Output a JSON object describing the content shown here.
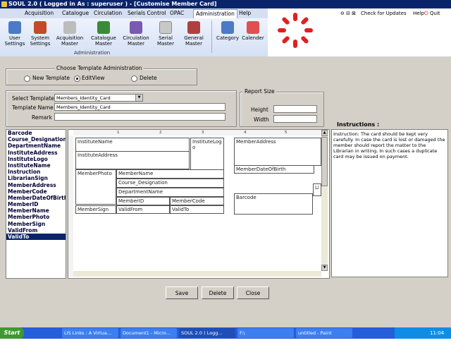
{
  "window": {
    "title": "SOUL 2.0  ( Logged in As : superuser ) - [Customise Member Card]"
  },
  "menu": {
    "items": [
      "Acquisition",
      "Catalogue",
      "Circulation",
      "Serials Control",
      "OPAC",
      "Administration",
      "Help"
    ],
    "active": "Administration"
  },
  "ribbon": {
    "buttons": [
      {
        "label1": "User",
        "label2": "Settings",
        "color": "#4a7ac8"
      },
      {
        "label1": "System",
        "label2": "Settings",
        "color": "#c24a2a"
      },
      {
        "label1": "Acquisition",
        "label2": "Master",
        "color": "#d0d0d0"
      },
      {
        "label1": "Catalogue",
        "label2": "Master",
        "color": "#3a8a3a"
      },
      {
        "label1": "Circulation",
        "label2": "Master",
        "color": "#7a5ab0"
      },
      {
        "label1": "Serial",
        "label2": "Master",
        "color": "#c8c8c8"
      },
      {
        "label1": "General",
        "label2": "Master",
        "color": "#b04040"
      },
      {
        "label1": "Category",
        "label2": "",
        "color": "#4a7ac8"
      },
      {
        "label1": "Calender",
        "label2": "",
        "color": "#e05050"
      }
    ],
    "group_label": "Administration"
  },
  "top_right": {
    "check_updates": "Check for Updates",
    "help": "Help",
    "quit": "Quit"
  },
  "template_admin": {
    "legend": "Choose Template Administration",
    "options": [
      {
        "label": "New Template",
        "selected": false
      },
      {
        "label": "EditView",
        "selected": true
      },
      {
        "label": "Delete",
        "selected": false
      }
    ]
  },
  "form": {
    "select_template_label": "Select Template",
    "select_template_value": "Members_Identity_Card",
    "template_name_label": "Template Name",
    "template_name_value": "Members_Identity_Card",
    "remark_label": "Remark",
    "remark_value": ""
  },
  "report_size": {
    "legend": "Report Size",
    "height_label": "Height",
    "height_value": "",
    "width_label": "Width",
    "width_value": ""
  },
  "fields": {
    "items": [
      "Barcode",
      "Course_Designation",
      "DepartmentName",
      "InstituteAddress",
      "InstituteLogo",
      "InstituteName",
      "Instruction",
      "LibrarianSign",
      "MemberAddress",
      "MemberCode",
      "MemberDateOfBirth",
      "MemberID",
      "MemberName",
      "MemberPhoto",
      "MemberSign",
      "ValidFrom",
      "ValidTo"
    ],
    "selected": "ValidTo"
  },
  "canvas": {
    "ruler_marks": [
      "1",
      "2",
      "3",
      "4",
      "5"
    ],
    "boxes": {
      "institute_name": "InstituteName",
      "institute_logo": "InstituteLogo",
      "institute_address": "InstituteAddress",
      "member_photo": "MemberPhoto",
      "member_name": "MemberName",
      "course_designation": "Course_Designation",
      "department_name": "DepartmentName",
      "member_id": "MemberID",
      "member_code": "MemberCode",
      "member_sign": "MemberSign",
      "valid_from": "ValidFrom",
      "valid_to": "ValidTo",
      "member_address": "MemberAddress",
      "member_dob": "MemberDateOfBirth",
      "barcode": "Barcode",
      "li_partial": "Li"
    }
  },
  "instructions": {
    "title": "Instructions :",
    "text": "Instruction: The card should be kept very carefully. In case the card is lost or damaged the member should report the matter to the Librarian in writing. In such cases a duplicate card may be issued on payment."
  },
  "buttons": {
    "save": "Save",
    "delete": "Delete",
    "close": "Close"
  },
  "taskbar": {
    "start": "Start",
    "tasks": [
      "LIS Links : A Virtua...",
      "Document1 - Micro...",
      "SOUL 2.0 ( Logg...",
      "F:\\",
      "untitled - Paint"
    ],
    "active_task": "SOUL 2.0 ( Logg...",
    "clock": "11:04 AM"
  }
}
